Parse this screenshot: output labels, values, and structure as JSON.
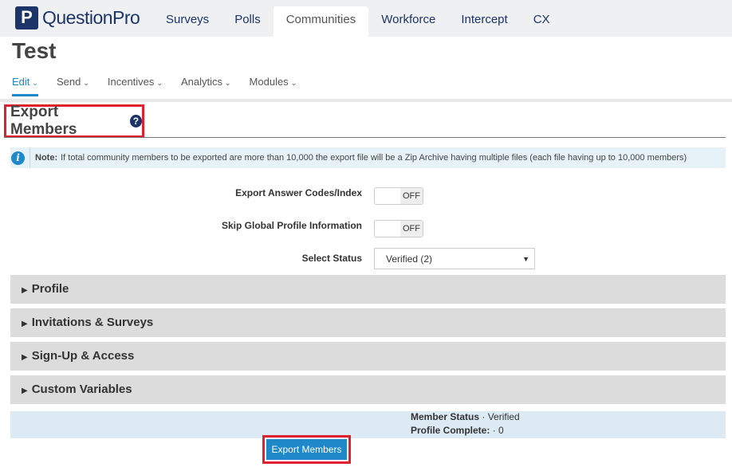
{
  "brand": {
    "name": "QuestionPro",
    "mark": "P"
  },
  "top_nav": [
    {
      "label": "Surveys"
    },
    {
      "label": "Polls"
    },
    {
      "label": "Communities",
      "active": true
    },
    {
      "label": "Workforce"
    },
    {
      "label": "Intercept"
    },
    {
      "label": "CX"
    }
  ],
  "page_title": "Test",
  "sub_nav": [
    {
      "label": "Edit",
      "active": true
    },
    {
      "label": "Send"
    },
    {
      "label": "Incentives"
    },
    {
      "label": "Analytics"
    },
    {
      "label": "Modules"
    }
  ],
  "section": {
    "title": "Export Members",
    "help_icon": "question-circle-icon"
  },
  "note": {
    "label": "Note:",
    "text": "If total community members to be exported are more than 10,000 the export file will be a Zip Archive having multiple files (each file having up to 10,000 members)"
  },
  "form": {
    "export_answer_codes": {
      "label": "Export Answer Codes/Index",
      "state": "OFF"
    },
    "skip_global_profile": {
      "label": "Skip Global Profile Information",
      "state": "OFF"
    },
    "select_status": {
      "label": "Select Status",
      "value": "Verified (2)"
    }
  },
  "accordions": [
    {
      "label": "Profile"
    },
    {
      "label": "Invitations & Surveys"
    },
    {
      "label": "Sign-Up & Access"
    },
    {
      "label": "Custom Variables"
    }
  ],
  "summary": {
    "member_status_label": "Member Status",
    "member_status_value": " · Verified",
    "profile_complete_label": "Profile Complete:",
    "profile_complete_value": " · 0"
  },
  "export_button": "Export Members",
  "colors": {
    "brand": "#1d3468",
    "accent": "#1e88c8",
    "highlight": "#e0202e"
  }
}
